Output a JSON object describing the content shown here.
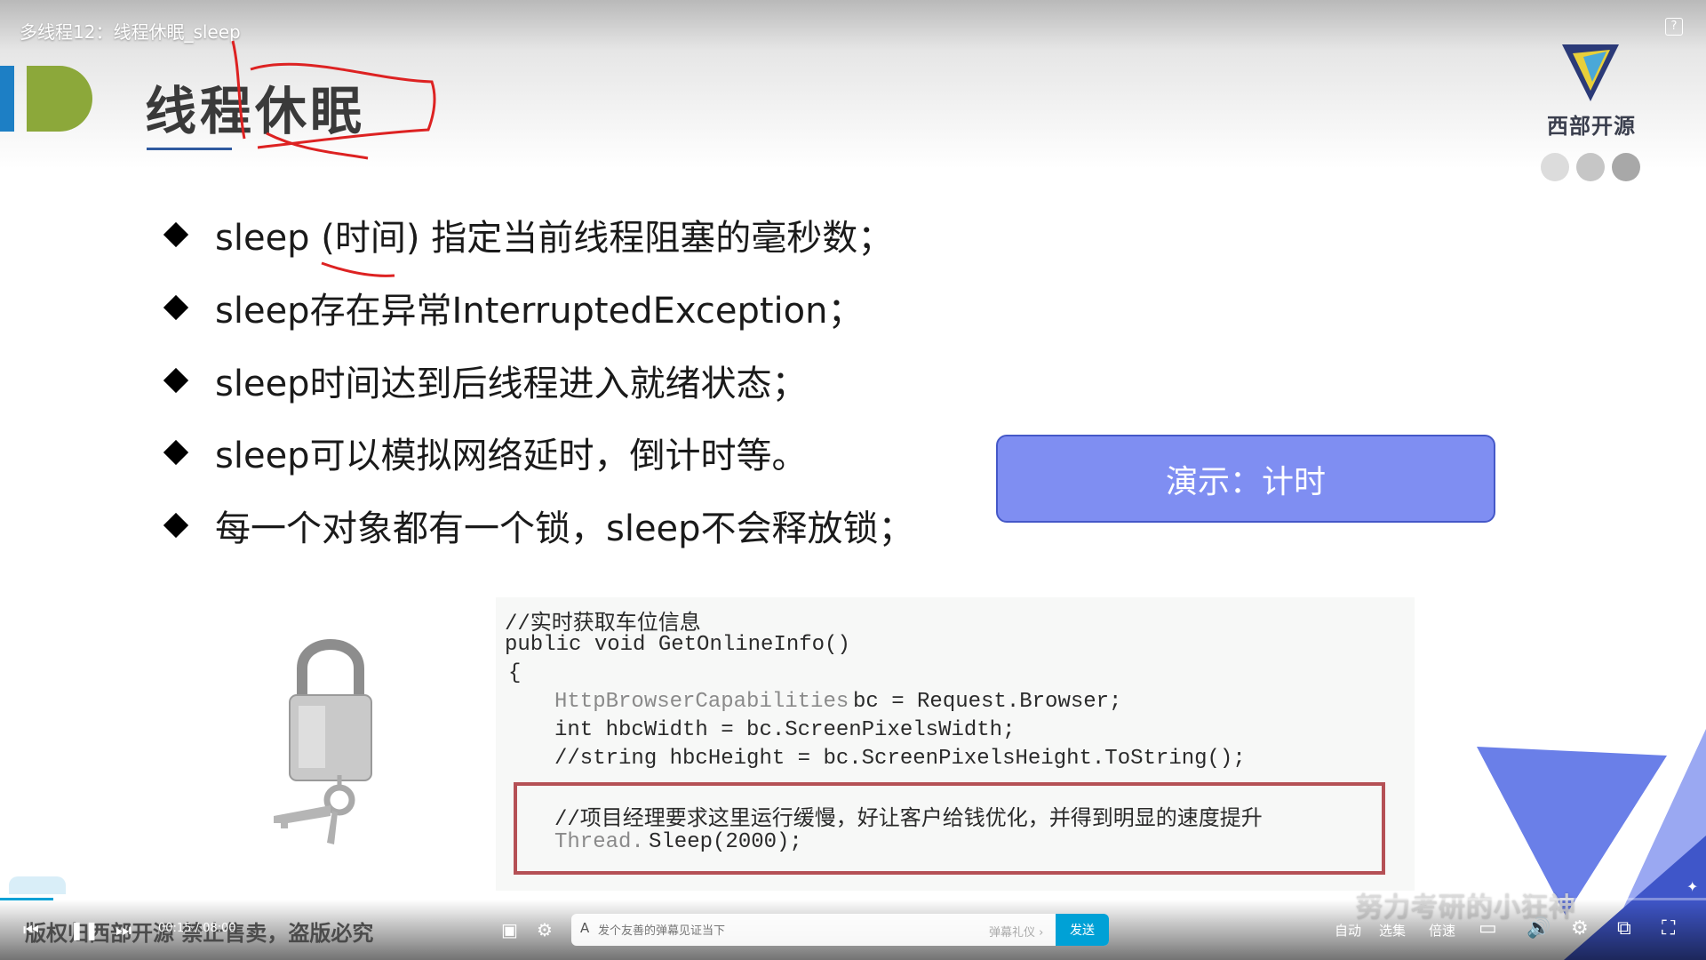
{
  "video": {
    "title": "多线程12：线程休眠_sleep"
  },
  "slide": {
    "title": "线程休眠",
    "brand": {
      "name": "西部开源",
      "colors": {
        "logo_blue": "#1d7fc5",
        "logo_green": "#8ca83a"
      }
    },
    "bullets": [
      "sleep (时间) 指定当前线程阻塞的毫秒数；",
      "sleep存在异常InterruptedException；",
      "sleep时间达到后线程进入就绪状态；",
      "sleep可以模拟网络延时，倒计时等。",
      "每一个对象都有一个锁，sleep不会释放锁；"
    ],
    "demo_label": "演示：计时",
    "code": {
      "lines": [
        "//实时获取车位信息",
        "public void GetOnlineInfo()",
        "{",
        "HttpBrowserCapabilities",
        "bc = Request.Browser;",
        "int hbcWidth = bc.ScreenPixelsWidth;",
        "//string hbcHeight = bc.ScreenPixelsHeight.ToString();",
        "//项目经理要求这里运行缓慢，好让客户给钱优化，并得到明显的速度提升",
        "Thread.",
        "Sleep(2000);"
      ]
    }
  },
  "watermark": "努力考研的小狂神",
  "player": {
    "copyright": "版权归西部开源 禁止售卖，盗版必究",
    "time": "00:15 / 08:00",
    "danmaku_placeholder": "发个友善的弹幕见证当下",
    "danmaku_etiquette": "弹幕礼仪 ›",
    "send_label": "发送",
    "auto_label": "自动",
    "episodes_label": "选集",
    "speed_label": "倍速",
    "progress_fraction": 0.031,
    "accent_color": "#00a1d6"
  }
}
